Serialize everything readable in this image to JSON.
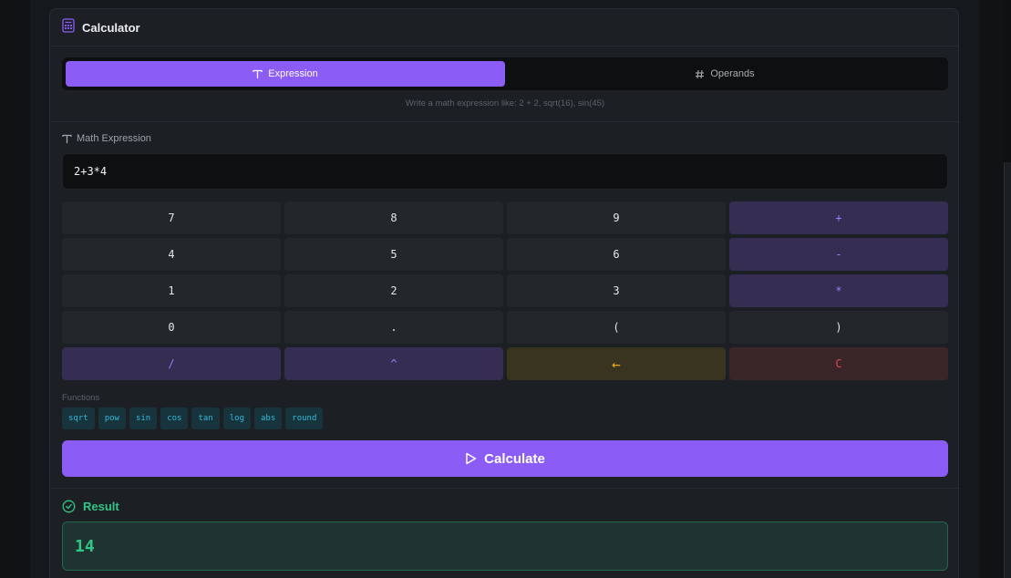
{
  "header": {
    "title": "Calculator",
    "icon": "calculator-icon"
  },
  "tabs": [
    {
      "label": "Expression",
      "icon": "text-icon",
      "active": true
    },
    {
      "label": "Operands",
      "icon": "hash-icon",
      "active": false
    }
  ],
  "hint": "Write a math expression like: 2 + 2, sqrt(16), sin(45)",
  "expression": {
    "label": "Math Expression",
    "value": "2+3*4"
  },
  "keypad": {
    "rows": [
      [
        "7",
        "8",
        "9",
        "+"
      ],
      [
        "4",
        "5",
        "6",
        "-"
      ],
      [
        "1",
        "2",
        "3",
        "*"
      ],
      [
        "0",
        ".",
        "(",
        ")"
      ],
      [
        "/",
        "^",
        "←",
        "C"
      ]
    ]
  },
  "functions": {
    "label": "Functions",
    "items": [
      "sqrt",
      "pow",
      "sin",
      "cos",
      "tan",
      "log",
      "abs",
      "round"
    ]
  },
  "calculate": {
    "label": "Calculate",
    "icon": "play-icon"
  },
  "result": {
    "label": "Result",
    "value": "14",
    "icon": "check-circle-icon"
  },
  "colors": {
    "accent": "#8b5cf6",
    "success": "#2fc785",
    "function_chip": "#35b8d9",
    "backspace": "#e8a51c",
    "clear": "#e0464e"
  }
}
